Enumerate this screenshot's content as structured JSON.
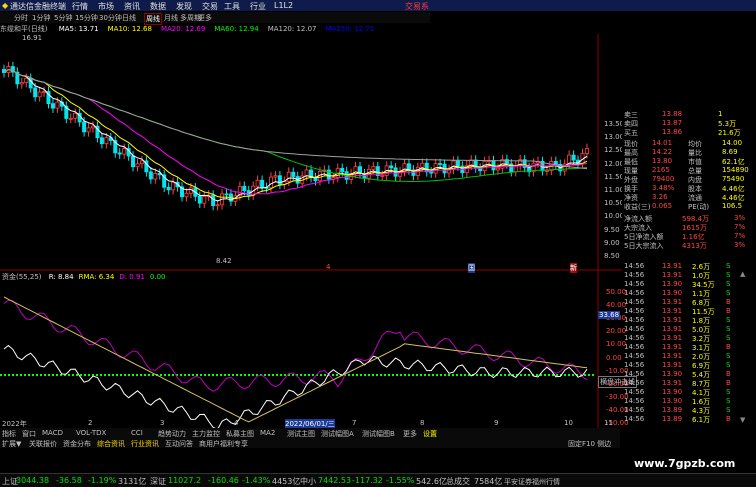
{
  "titlebar": {
    "app_title": "通达信金融终端",
    "menu": [
      "行情",
      "市场",
      "资讯",
      "数据",
      "发现",
      "交易",
      "工具",
      "行业",
      "L1L2"
    ],
    "right_label": "交易系"
  },
  "periodbar": {
    "items": [
      "分时",
      "1分钟",
      "5分钟",
      "15分钟",
      "30分钟",
      "日线",
      "周线",
      "月线",
      "多周期",
      "更多"
    ],
    "selected": "日线"
  },
  "ma_line": {
    "stock": "东缆和平(日线)",
    "items": [
      {
        "text": "MA5: 13.71",
        "color": "#ffffff"
      },
      {
        "text": "MA10: 12.68",
        "color": "#ffff00"
      },
      {
        "text": "MA20: 12.69",
        "color": "#ff00ff"
      },
      {
        "text": "MA60: 12.94",
        "color": "#00ff00"
      },
      {
        "text": "MA120: 12.07",
        "color": "#c0c0c0"
      },
      {
        "text": "MA250: 12.71",
        "color": "#0000ff"
      }
    ]
  },
  "kline": {
    "high_label": "16.91",
    "low_label": "8.42",
    "price_axis": [
      "13.50",
      "13.00",
      "12.50",
      "12.00",
      "11.50",
      "11.00",
      "10.50",
      "10.00",
      "9.50",
      "9.00",
      "8.50"
    ],
    "month_marks": [
      "4",
      "国",
      "新"
    ]
  },
  "indicator": {
    "label": "资金(55,25)",
    "items": [
      {
        "text": "R: 8.84",
        "color": "#ffffff"
      },
      {
        "text": "RMA: 6.34",
        "color": "#ffff00"
      },
      {
        "text": "D: 0.91",
        "color": "#ff00ff"
      },
      {
        "text": "0.00",
        "color": "#00ff00"
      }
    ],
    "axis": [
      "50.00",
      "40.00",
      "30.00",
      "20.00",
      "10.00",
      "0.00",
      "-10.00",
      "-20.00",
      "-30.00",
      "-40.00",
      "-50.00"
    ],
    "badge": "33.68",
    "box_label": "横盘冲击线"
  },
  "dates": {
    "labels": [
      "2022年",
      "2",
      "3",
      "4",
      "2022/06/01/三",
      "7",
      "8",
      "9",
      "10",
      "11"
    ]
  },
  "quote": {
    "rows": [
      {
        "k": "卖三",
        "v": "13.88",
        "n": "1",
        "c": "#ff4444"
      },
      {
        "k": "卖四",
        "v": "13.87",
        "n": "5.3万",
        "c": "#ff4444"
      },
      {
        "k": "买五",
        "v": "13.86",
        "n": "21.6万",
        "c": "#ff4444"
      }
    ],
    "stats": [
      {
        "a": "现价",
        "av": "14.01",
        "b": "均价",
        "bv": "14.00"
      },
      {
        "a": "最高",
        "av": "14.22",
        "b": "量比",
        "bv": "8.69"
      },
      {
        "a": "最低",
        "av": "13.80",
        "b": "市值",
        "bv": "62.1亿"
      },
      {
        "a": "现量",
        "av": "2165",
        "b": "总量",
        "bv": "154890"
      },
      {
        "a": "外盘",
        "av": "79400",
        "b": "内盘",
        "bv": "75490"
      },
      {
        "a": "换手",
        "av": "3.48%",
        "b": "股本",
        "bv": "4.46亿"
      },
      {
        "a": "净资",
        "av": "3.26",
        "b": "流通",
        "bv": "4.46亿"
      },
      {
        "a": "收益(三)",
        "av": "0.065",
        "b": "PE(动)",
        "bv": "106.5"
      }
    ],
    "flows": [
      {
        "k": "净流入额",
        "v": "598.4万",
        "p": "3%"
      },
      {
        "k": "大宗流入",
        "v": "1615万",
        "p": "7%"
      },
      {
        "k": "5日净流入额",
        "v": "1.16亿",
        "p": "7%"
      },
      {
        "k": "5日大宗流入",
        "v": "4313万",
        "p": "3%"
      }
    ]
  },
  "ticks": [
    {
      "t": "14:56",
      "p": "13.91",
      "v": "2.6万",
      "s": "S"
    },
    {
      "t": "14:56",
      "p": "13.91",
      "v": "1.0万",
      "s": "S"
    },
    {
      "t": "14:56",
      "p": "13.90",
      "v": "34.5万",
      "s": "S"
    },
    {
      "t": "14:56",
      "p": "13.90",
      "v": "1.1万",
      "s": "S"
    },
    {
      "t": "14:56",
      "p": "13.91",
      "v": "6.8万",
      "s": "B"
    },
    {
      "t": "14:56",
      "p": "13.91",
      "v": "11.5万",
      "s": "B"
    },
    {
      "t": "14:56",
      "p": "13.91",
      "v": "1.8万",
      "s": "S"
    },
    {
      "t": "14:56",
      "p": "13.91",
      "v": "5.0万",
      "s": "S"
    },
    {
      "t": "14:56",
      "p": "13.91",
      "v": "3.2万",
      "s": "S"
    },
    {
      "t": "14:56",
      "p": "13.91",
      "v": "3.1万",
      "s": "B"
    },
    {
      "t": "14:56",
      "p": "13.91",
      "v": "2.0万",
      "s": "S"
    },
    {
      "t": "14:56",
      "p": "13.91",
      "v": "6.9万",
      "s": "S"
    },
    {
      "t": "14:56",
      "p": "13.90",
      "v": "5.4万",
      "s": "B"
    },
    {
      "t": "14:56",
      "p": "13.91",
      "v": "8.7万",
      "s": "B"
    },
    {
      "t": "14:56",
      "p": "13.90",
      "v": "4.1万",
      "s": "S"
    },
    {
      "t": "14:56",
      "p": "13.90",
      "v": "1.6万",
      "s": "S"
    },
    {
      "t": "14:56",
      "p": "13.89",
      "v": "4.3万",
      "s": "S"
    },
    {
      "t": "14:56",
      "p": "13.89",
      "v": "6.1万",
      "s": "B"
    }
  ],
  "tabbar": {
    "items": [
      "指标",
      "窗口",
      "MACD",
      "VOL-TDX",
      "CCI",
      "趋势动力",
      "主力监控",
      "私募主图",
      "MA2",
      "测试主图",
      "测试幅图A",
      "测试幅图B",
      "更多",
      "设置"
    ]
  },
  "tabbar2": {
    "items": [
      "扩展▼",
      "关联报价",
      "资金分布",
      "综合资讯",
      "行业资讯",
      "互动问答",
      "商用户福利专享"
    ],
    "right": "固定F10 侧边"
  },
  "statusbar": {
    "segments": [
      {
        "text": "上证",
        "color": "#c0c0c0"
      },
      {
        "text": "3044.38",
        "color": "#00e000"
      },
      {
        "text": "-36.58",
        "color": "#00e000"
      },
      {
        "text": "-1.19%",
        "color": "#00e000"
      },
      {
        "text": "3131亿",
        "color": "#c0c0c0"
      },
      {
        "text": "深证",
        "color": "#c0c0c0"
      },
      {
        "text": "11027.2",
        "color": "#00e000"
      },
      {
        "text": "-160.46",
        "color": "#00e000"
      },
      {
        "text": "-1.43%",
        "color": "#00e000"
      },
      {
        "text": "4453亿",
        "color": "#c0c0c0"
      },
      {
        "text": "中小",
        "color": "#c0c0c0"
      },
      {
        "text": "7442.53",
        "color": "#00e000"
      },
      {
        "text": "-117.32",
        "color": "#00e000"
      },
      {
        "text": "-1.55%",
        "color": "#00e000"
      },
      {
        "text": "542.6亿",
        "color": "#c0c0c0"
      },
      {
        "text": "总成交",
        "color": "#c0c0c0"
      },
      {
        "text": "7584亿",
        "color": "#c0c0c0"
      },
      {
        "text": "平安证券福州行情",
        "color": "#c0c0c0"
      }
    ]
  },
  "watermark": "www.7gpzb.com"
}
